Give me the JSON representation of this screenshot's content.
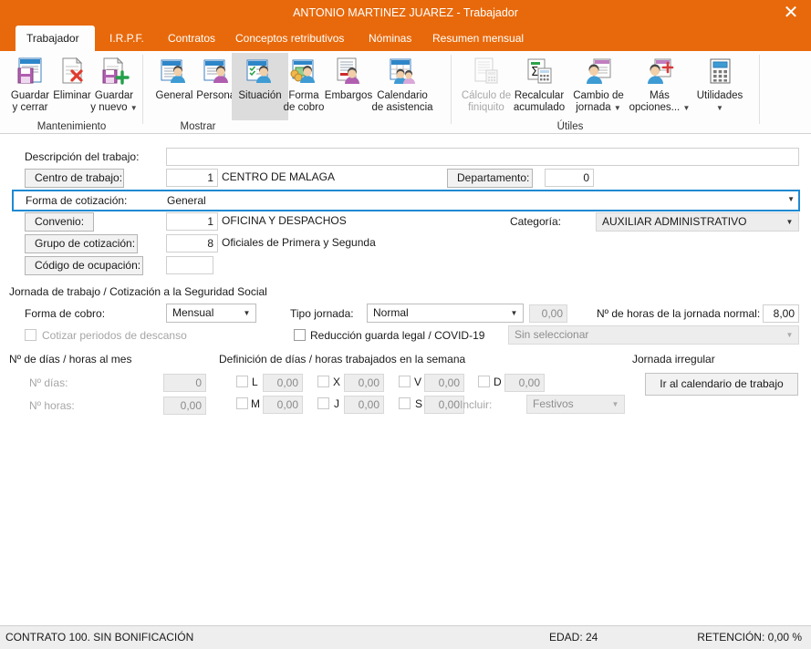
{
  "window": {
    "title": "ANTONIO MARTINEZ JUAREZ - Trabajador",
    "close_icon": "close-icon",
    "accent_color": "#e8690b"
  },
  "tabs": [
    {
      "label": "Trabajador",
      "active": true
    },
    {
      "label": "I.R.P.F.",
      "active": false
    },
    {
      "label": "Contratos",
      "active": false
    },
    {
      "label": "Conceptos retributivos",
      "active": false
    },
    {
      "label": "Nóminas",
      "active": false
    },
    {
      "label": "Resumen mensual",
      "active": false
    }
  ],
  "ribbon": {
    "groups": [
      {
        "caption": "Mantenimiento"
      },
      {
        "caption": "Mostrar"
      },
      {
        "caption": "Útiles"
      }
    ],
    "buttons": [
      {
        "label": "Guardar\ny cerrar",
        "icon": "save-close-icon"
      },
      {
        "label": "Eliminar",
        "icon": "delete-icon"
      },
      {
        "label": "Guardar\ny nuevo",
        "icon": "save-new-icon",
        "caret": true
      },
      {
        "label": "General",
        "icon": "worker-general-icon"
      },
      {
        "label": "Personal",
        "icon": "worker-personal-icon"
      },
      {
        "label": "Situación",
        "icon": "worker-situation-icon",
        "selected": true
      },
      {
        "label": "Forma\nde cobro",
        "icon": "payment-method-icon"
      },
      {
        "label": "Embargos",
        "icon": "garnishment-icon"
      },
      {
        "label": "Calendario\nde asistencia",
        "icon": "attendance-calendar-icon"
      },
      {
        "label": "Cálculo de\nfiniquito",
        "icon": "settlement-calc-icon",
        "disabled": true
      },
      {
        "label": "Recalcular\nacumulado",
        "icon": "recalc-icon"
      },
      {
        "label": "Cambio de\njornada",
        "icon": "workday-change-icon",
        "caret": true
      },
      {
        "label": "Más\nopciones...",
        "icon": "more-options-icon",
        "caret": true
      },
      {
        "label": "Utilidades",
        "icon": "utilities-icon",
        "caret": true
      }
    ]
  },
  "form": {
    "descripcion_label": "Descripción del trabajo:",
    "descripcion_value": "",
    "centro_label": "Centro de trabajo:",
    "centro_code": "1",
    "centro_name": "CENTRO DE MALAGA",
    "departamento_label": "Departamento:",
    "departamento_value": "0",
    "forma_cotizacion_label": "Forma de cotización:",
    "forma_cotizacion_value": "General",
    "convenio_label": "Convenio:",
    "convenio_code": "1",
    "convenio_name": "OFICINA Y DESPACHOS",
    "categoria_label": "Categoría:",
    "categoria_value": "AUXILIAR ADMINISTRATIVO",
    "grupo_label": "Grupo de cotización:",
    "grupo_code": "8",
    "grupo_name": "Oficiales de Primera y Segunda",
    "ocupacion_label": "Código de ocupación:",
    "ocupacion_value": ""
  },
  "jornada": {
    "section_title": "Jornada de trabajo / Cotización a la Seguridad Social",
    "forma_cobro_label": "Forma de cobro:",
    "forma_cobro_value": "Mensual",
    "tipo_jornada_label": "Tipo jornada:",
    "tipo_jornada_value": "Normal",
    "tipo_jornada_pct": "0,00",
    "horas_normal_label": "Nº de horas de la jornada normal:",
    "horas_normal_value": "8,00",
    "cotizar_descanso_label": "Cotizar periodos de descanso",
    "cotizar_descanso_checked": false,
    "reduccion_label": "Reducción guarda legal / COVID-19",
    "reduccion_checked": false,
    "reduccion_select_value": "Sin seleccionar"
  },
  "mes": {
    "section_title": "Nº de días / horas al mes",
    "dias_label": "Nº días:",
    "dias_value": "0",
    "horas_label": "Nº horas:",
    "horas_value": "0,00"
  },
  "semana": {
    "section_title": "Definición de días / horas trabajados en la semana",
    "days": [
      {
        "key": "L",
        "value": "0,00",
        "checked": false
      },
      {
        "key": "M",
        "value": "0,00",
        "checked": false
      },
      {
        "key": "X",
        "value": "0,00",
        "checked": false
      },
      {
        "key": "J",
        "value": "0,00",
        "checked": false
      },
      {
        "key": "V",
        "value": "0,00",
        "checked": false
      },
      {
        "key": "S",
        "value": "0,00",
        "checked": false
      },
      {
        "key": "D",
        "value": "0,00",
        "checked": false
      }
    ],
    "incluir_label": "Incluir:",
    "incluir_value": "Festivos"
  },
  "irregular": {
    "section_title": "Jornada irregular",
    "button_label": "Ir al calendario de trabajo"
  },
  "statusbar": {
    "contrato": "CONTRATO 100.  SIN BONIFICACIÓN",
    "edad": "EDAD: 24",
    "retencion": "RETENCIÓN: 0,00 %"
  }
}
